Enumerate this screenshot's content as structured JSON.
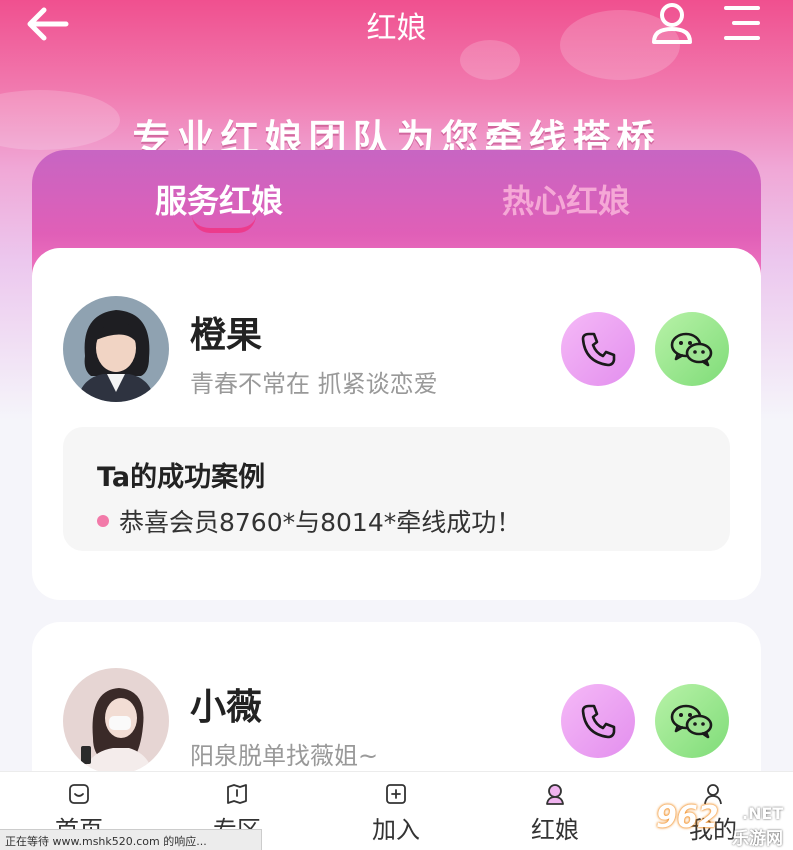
{
  "header": {
    "title": "红娘",
    "back_icon": "arrow-left-icon",
    "user_icon": "user-icon",
    "menu_icon": "menu-icon"
  },
  "banner": {
    "slogan": "专业红娘团队为您牵线搭桥"
  },
  "tabs": [
    {
      "label": "服务红娘",
      "active": true
    },
    {
      "label": "热心红娘",
      "active": false
    }
  ],
  "matchmakers": [
    {
      "name": "橙果",
      "motto": "青春不常在 抓紧谈恋爱",
      "case_title": "Ta的成功案例",
      "case_text": "恭喜会员8760*与8014*牵线成功！"
    },
    {
      "name": "小薇",
      "motto": "阳泉脱单找薇姐~"
    }
  ],
  "bottom_nav": [
    {
      "label": "首页",
      "icon": "home-icon"
    },
    {
      "label": "专区",
      "icon": "book-icon"
    },
    {
      "label": "加入",
      "icon": "plus-square-icon"
    },
    {
      "label": "红娘",
      "icon": "matchmaker-icon",
      "active": true
    },
    {
      "label": "我的",
      "icon": "profile-icon"
    }
  ],
  "status_bar": {
    "text": "正在等待 www.mshk520.com 的响应..."
  },
  "watermark": {
    "main": "962",
    "net": ".NET",
    "site": "乐游网"
  },
  "colors": {
    "accent_pink": "#ec3b8c",
    "call_button": "#e38fee",
    "wechat_button": "#7fdc78"
  }
}
